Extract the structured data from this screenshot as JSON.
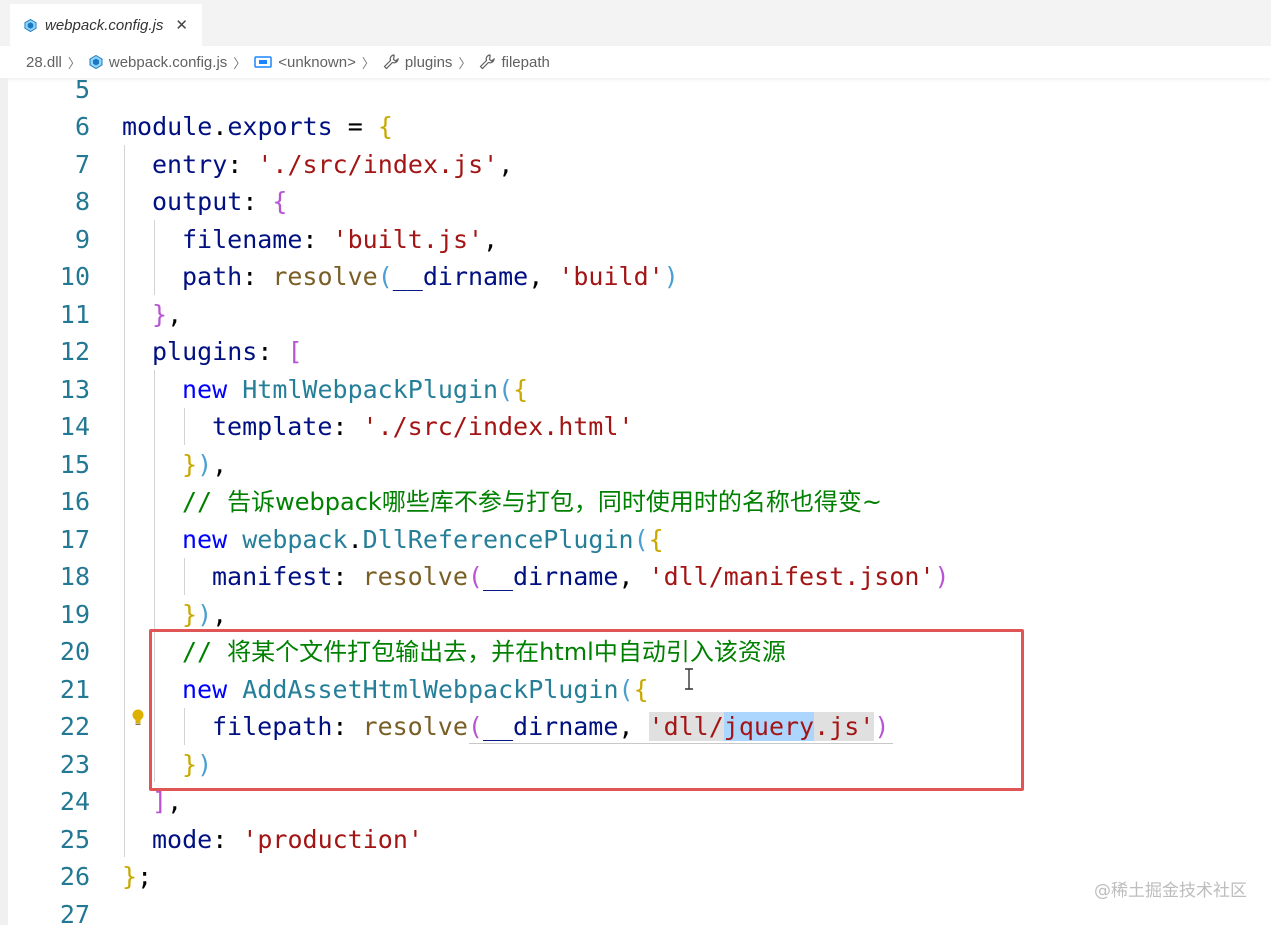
{
  "tab": {
    "label": "webpack.config.js",
    "close": "✕",
    "icon": "webpack-icon"
  },
  "breadcrumb": {
    "items": [
      {
        "label": "28.dll",
        "icon": ""
      },
      {
        "label": "webpack.config.js",
        "icon": "webpack-icon"
      },
      {
        "label": "<unknown>",
        "icon": "variable-icon"
      },
      {
        "label": "plugins",
        "icon": "wrench-icon"
      },
      {
        "label": "filepath",
        "icon": "wrench-icon"
      }
    ],
    "separator": "〉"
  },
  "editor": {
    "line_numbers": [
      "5",
      "6",
      "7",
      "8",
      "9",
      "10",
      "11",
      "12",
      "13",
      "14",
      "15",
      "16",
      "17",
      "18",
      "19",
      "20",
      "21",
      "22",
      "23",
      "24",
      "25",
      "26",
      "27"
    ],
    "lines": {
      "l6": [
        "module",
        ".",
        "exports",
        " = ",
        "{"
      ],
      "l7": [
        "entry",
        ": ",
        "'./src/index.js'",
        ","
      ],
      "l8": [
        "output",
        ": ",
        "{"
      ],
      "l9": [
        "filename",
        ": ",
        "'built.js'",
        ","
      ],
      "l10": [
        "path",
        ": ",
        "resolve",
        "(",
        "__dirname",
        ", ",
        "'build'",
        ")"
      ],
      "l11": [
        "}",
        ","
      ],
      "l12": [
        "plugins",
        ": ",
        "["
      ],
      "l13": [
        "new ",
        "HtmlWebpackPlugin",
        "(",
        "{"
      ],
      "l14": [
        "template",
        ": ",
        "'./src/index.html'"
      ],
      "l15": [
        "}",
        ")",
        ","
      ],
      "l16": [
        "// ",
        "告诉webpack哪些库不参与打包，同时使用时的名称也得变~"
      ],
      "l17": [
        "new ",
        "webpack",
        ".",
        "DllReferencePlugin",
        "(",
        "{"
      ],
      "l18": [
        "manifest",
        ": ",
        "resolve",
        "(",
        "__dirname",
        ", ",
        "'dll/manifest.json'",
        ")"
      ],
      "l19": [
        "}",
        ")",
        ","
      ],
      "l20": [
        "// ",
        "将某个文件打包输出去，并在html中自动引入该资源"
      ],
      "l21": [
        "new ",
        "AddAssetHtmlWebpackPlugin",
        "(",
        "{"
      ],
      "l22": [
        "filepath",
        ": ",
        "resolve",
        "(",
        "__dirname",
        ", ",
        "'dll/",
        "jquery",
        ".js'",
        ")"
      ],
      "l23": [
        "}",
        ")"
      ],
      "l24": [
        "]",
        ","
      ],
      "l25": [
        "mode",
        ": ",
        "'production'"
      ],
      "l26": [
        "}",
        ";"
      ]
    },
    "colors": {
      "line_number": "#237893",
      "variable": "#001080",
      "string": "#a31515",
      "keyword": "#0000ff",
      "class": "#267f99",
      "function": "#795e26",
      "comment": "#008000",
      "highlight_box": "#e05555",
      "selection": "#add6ff"
    }
  },
  "watermark": "@稀土掘金技术社区"
}
